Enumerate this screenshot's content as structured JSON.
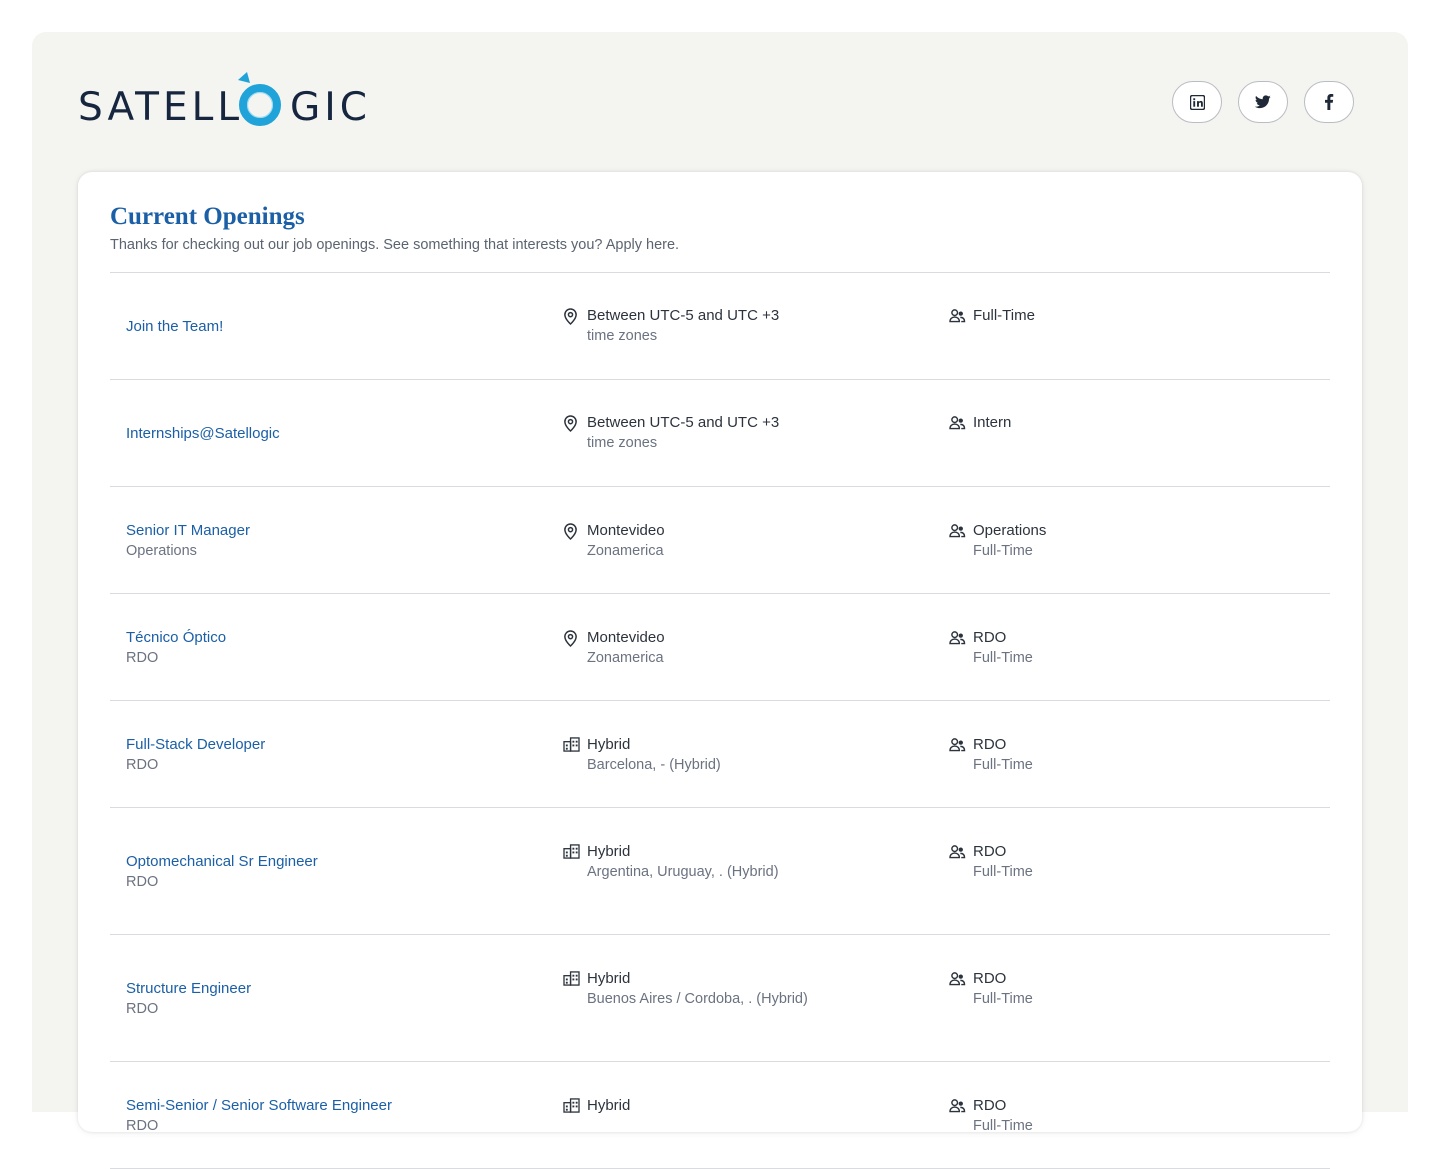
{
  "brand": {
    "logo_text_left": "SATELL",
    "logo_text_right": "GIC",
    "text_color": "#16263f",
    "ring_color": "#1fa3d9"
  },
  "social": [
    {
      "name": "linkedin",
      "icon": "linkedin-icon"
    },
    {
      "name": "twitter",
      "icon": "twitter-icon"
    },
    {
      "name": "facebook",
      "icon": "facebook-icon"
    }
  ],
  "openings": {
    "title": "Current Openings",
    "subtitle": "Thanks for checking out our job openings. See something that interests you? Apply here.",
    "jobs": [
      {
        "title": "Join the Team!",
        "dept": "",
        "loc_icon": "location-pin-icon",
        "loc_main": "Between UTC-5 and UTC +3",
        "loc_sub": "time zones",
        "type_main": "Full-Time",
        "type_sub": ""
      },
      {
        "title": "Internships@Satellogic",
        "dept": "",
        "loc_icon": "location-pin-icon",
        "loc_main": "Between UTC-5 and UTC +3",
        "loc_sub": "time zones",
        "type_main": "Intern",
        "type_sub": ""
      },
      {
        "title": "Senior IT Manager",
        "dept": "Operations",
        "loc_icon": "location-pin-icon",
        "loc_main": "Montevideo",
        "loc_sub": "Zonamerica",
        "type_main": "Operations",
        "type_sub": "Full-Time"
      },
      {
        "title": "Técnico Óptico",
        "dept": "RDO",
        "loc_icon": "location-pin-icon",
        "loc_main": "Montevideo",
        "loc_sub": "Zonamerica",
        "type_main": "RDO",
        "type_sub": "Full-Time"
      },
      {
        "title": "Full-Stack Developer",
        "dept": "RDO",
        "loc_icon": "building-icon",
        "loc_main": "Hybrid",
        "loc_sub": "Barcelona, - (Hybrid)",
        "type_main": "RDO",
        "type_sub": "Full-Time"
      },
      {
        "title": "Optomechanical Sr Engineer",
        "dept": "RDO",
        "loc_icon": "building-icon",
        "loc_main": "Hybrid",
        "loc_sub": "Argentina, Uruguay, . (Hybrid)",
        "type_main": "RDO",
        "type_sub": "Full-Time"
      },
      {
        "title": "Structure Engineer",
        "dept": "RDO",
        "loc_icon": "building-icon",
        "loc_main": "Hybrid",
        "loc_sub": "Buenos Aires / Cordoba, . (Hybrid)",
        "type_main": "RDO",
        "type_sub": "Full-Time"
      },
      {
        "title": "Semi-Senior / Senior Software Engineer",
        "dept": "RDO",
        "loc_icon": "building-icon",
        "loc_main": "Hybrid",
        "loc_sub": "",
        "type_main": "RDO",
        "type_sub": "Full-Time"
      }
    ]
  },
  "colors": {
    "accent": "#1b5fa6",
    "page_bg": "#f4f4f1",
    "card_bg": "#ffffff"
  }
}
